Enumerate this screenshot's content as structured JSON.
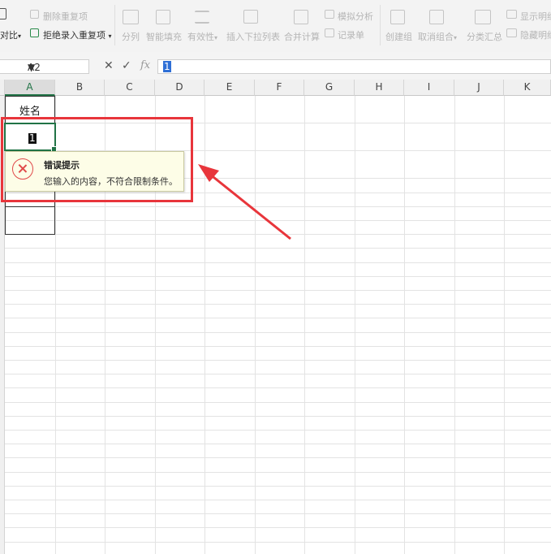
{
  "ribbon": {
    "compare_label": "对比",
    "delete_duplicates": "删除重复项",
    "reject_duplicates": "拒绝录入重复项",
    "split": "分列",
    "smart_fill": "智能填充",
    "validity": "有效性",
    "insert_dropdown": "插入下拉列表",
    "merge_calc": "合并计算",
    "simulate": "模拟分析",
    "record_form": "记录单",
    "create_group": "创建组",
    "ungroup": "取消组合",
    "subtotal": "分类汇总",
    "show_detail": "显示明细",
    "hide_detail": "隐藏明细"
  },
  "formula_bar": {
    "name_box": "A2",
    "cancel_glyph": "✕",
    "confirm_glyph": "✓",
    "fx_label": "fx",
    "value": "1"
  },
  "columns": [
    "A",
    "B",
    "C",
    "D",
    "E",
    "F",
    "G",
    "H",
    "I",
    "J",
    "K"
  ],
  "cells": {
    "a1": "姓名",
    "a2": "1"
  },
  "error_tip": {
    "title": "错误提示",
    "message": "您输入的内容，不符合限制条件。"
  },
  "colors": {
    "accent_green": "#217346",
    "annotation_red": "#e8353b",
    "error_red": "#e04a4a",
    "tooltip_bg": "#fdfde7"
  }
}
